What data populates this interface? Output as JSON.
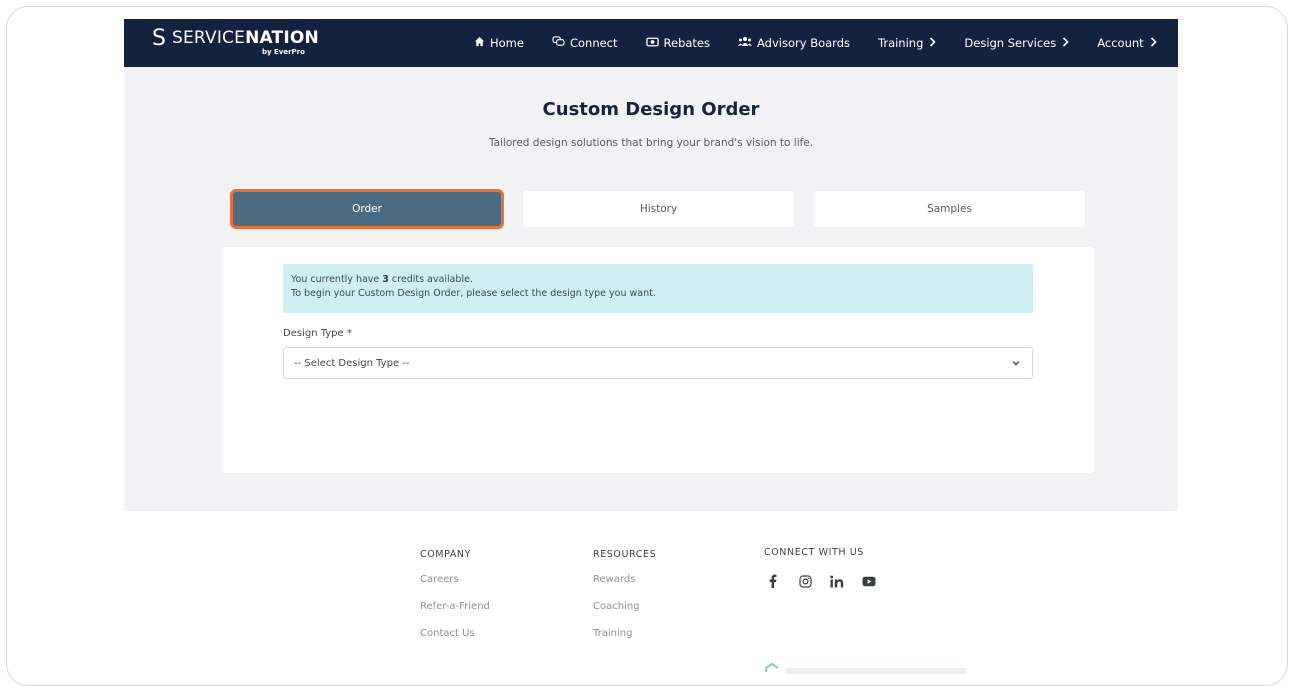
{
  "nav": {
    "logo_prefix": "SERVICE",
    "logo_bold": "NATION",
    "logo_sub": "by EverPro",
    "items": [
      {
        "label": "Home",
        "icon": "home-icon"
      },
      {
        "label": "Connect",
        "icon": "chat-icon"
      },
      {
        "label": "Rebates",
        "icon": "money-icon"
      },
      {
        "label": "Advisory Boards",
        "icon": "users-icon"
      },
      {
        "label": "Training",
        "icon": "chevron-right-icon"
      },
      {
        "label": "Design Services",
        "icon": "chevron-right-icon"
      },
      {
        "label": "Account",
        "icon": "chevron-right-icon"
      }
    ]
  },
  "header": {
    "title": "Custom Design Order",
    "subtitle": "Tailored design solutions that bring your brand's vision to life."
  },
  "tabs": [
    {
      "label": "Order",
      "active": true
    },
    {
      "label": "History",
      "active": false
    },
    {
      "label": "Samples",
      "active": false
    }
  ],
  "form": {
    "alert_line1_pre": "You currently have ",
    "alert_credits": "3",
    "alert_line1_post": " credits available.",
    "alert_line2": "To begin your Custom Design Order, please select the design type you want.",
    "design_type_label": "Design Type *",
    "design_type_value": "-- Select Design Type --"
  },
  "footer": {
    "company": {
      "heading": "COMPANY",
      "links": [
        "Careers",
        "Refer-a-Friend",
        "Contact Us"
      ]
    },
    "resources": {
      "heading": "RESOURCES",
      "links": [
        "Rewards",
        "Coaching",
        "Training"
      ]
    },
    "connect": {
      "heading": "CONNECT WITH US",
      "icons": [
        "facebook-icon",
        "instagram-icon",
        "linkedin-icon",
        "youtube-icon"
      ]
    }
  },
  "colors": {
    "nav_bg": "#13223f",
    "active_tab": "#4d6a83",
    "active_tab_border": "#e8713a",
    "alert_bg": "#cdeff2"
  }
}
